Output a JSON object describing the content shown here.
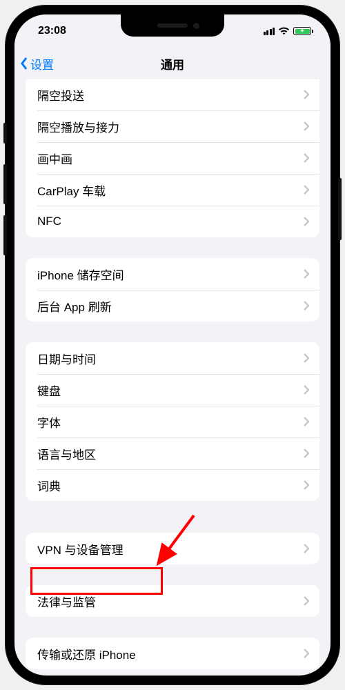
{
  "status": {
    "time": "23:08"
  },
  "nav": {
    "back_label": "设置",
    "title": "通用"
  },
  "groups": [
    {
      "rows": [
        "隔空投送",
        "隔空播放与接力",
        "画中画",
        "CarPlay 车载",
        "NFC"
      ]
    },
    {
      "rows": [
        "iPhone 储存空间",
        "后台 App 刷新"
      ]
    },
    {
      "rows": [
        "日期与时间",
        "键盘",
        "字体",
        "语言与地区",
        "词典"
      ]
    },
    {
      "rows": [
        "VPN 与设备管理"
      ]
    },
    {
      "rows": [
        "法律与监管"
      ]
    },
    {
      "rows": [
        "传输或还原 iPhone"
      ]
    }
  ],
  "annotation": {
    "highlight_target": "VPN 与设备管理"
  }
}
